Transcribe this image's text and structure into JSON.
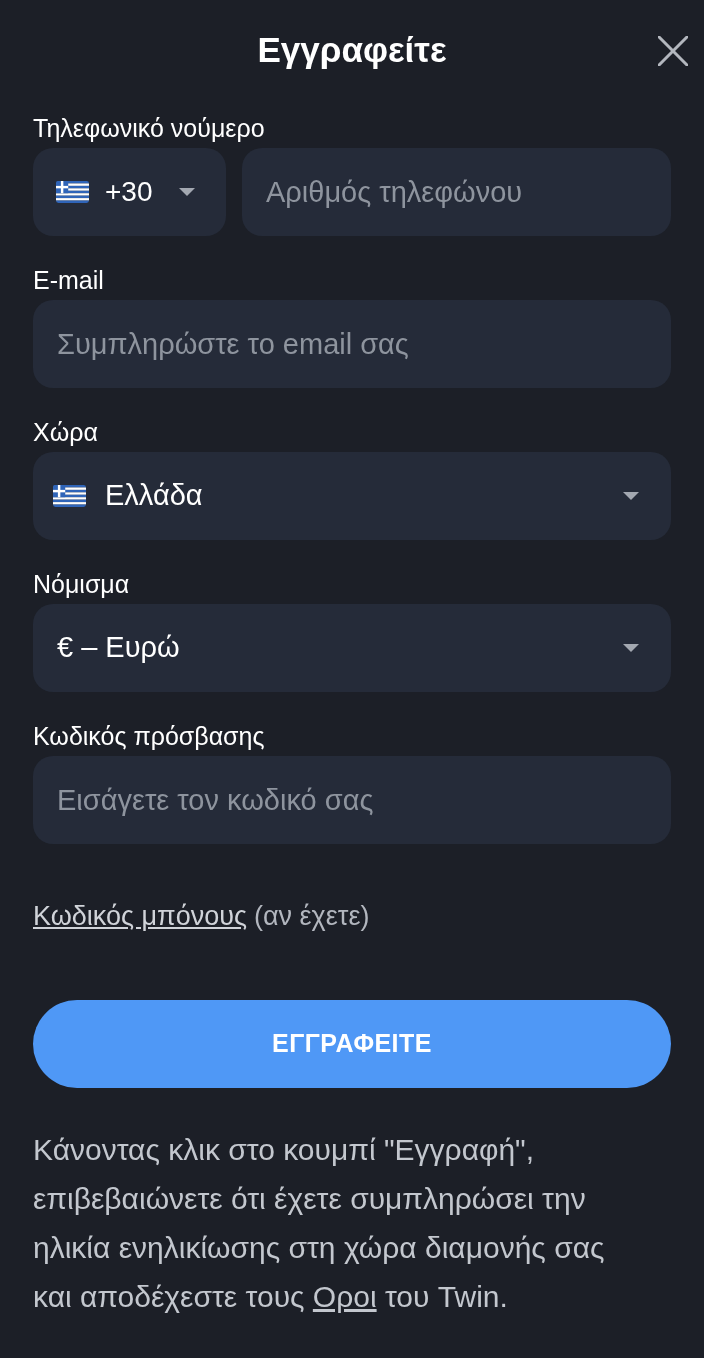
{
  "header": {
    "title": "Εγγραφείτε"
  },
  "fields": [
    {
      "kind": "phone",
      "label": "Τηλεφωνικό νούμερο",
      "code": "+30",
      "placeholder": "Αριθμός τηλεφώνου"
    },
    {
      "kind": "text",
      "label": "E-mail",
      "placeholder": "Συμπληρώστε το email σας"
    },
    {
      "kind": "country",
      "label": "Χώρα",
      "value": "Ελλάδα"
    },
    {
      "kind": "select",
      "label": "Νόμισμα",
      "value": "€ – Ευρώ"
    },
    {
      "kind": "password",
      "label": "Κωδικός πρόσβασης",
      "placeholder": "Εισάγετε τον κωδικό σας"
    }
  ],
  "bonus": {
    "link": "Κωδικός μπόνους",
    "note": "(αν έχετε)"
  },
  "submit_button": "ΕΓΓΡΑΦΕΙΤΕ",
  "disclaimer": {
    "text": "Κάνοντας κλικ στο κουμπί \"Εγγραφή\", επιβεβαιώνετε ότι έχετε συμπληρώσει την ηλικία ενηλικίωσης στη χώρα διαμονής σας και αποδέχεστε τους ",
    "link": "Οροι",
    "after": " του Twin."
  }
}
